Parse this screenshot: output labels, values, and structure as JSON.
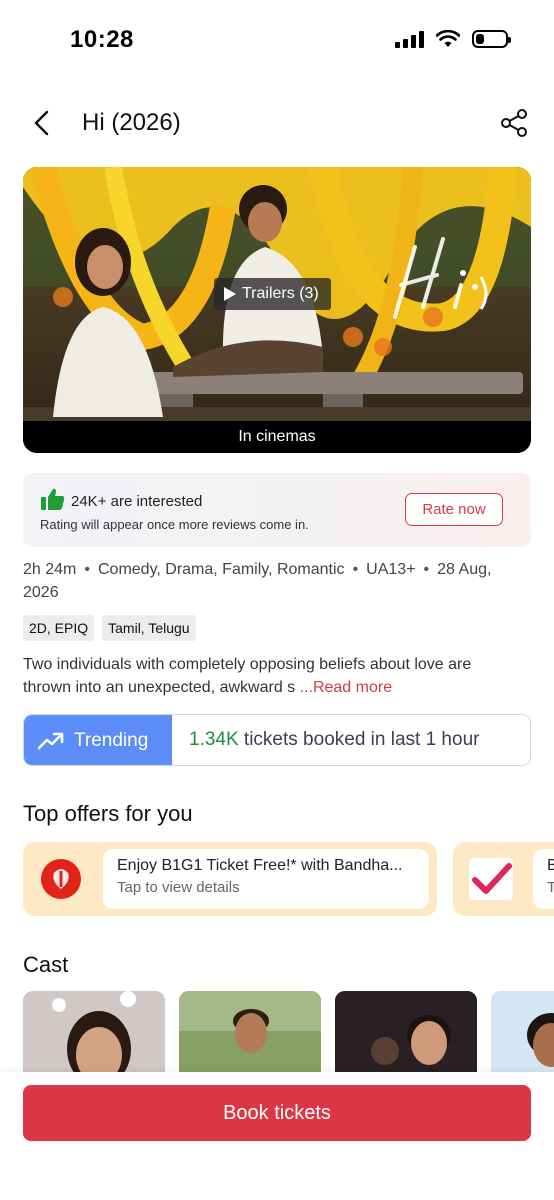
{
  "status_bar": {
    "time": "10:28",
    "battery_level": 0.3
  },
  "header": {
    "title": "Hi (2026)",
    "back_icon": "chevron-left-icon",
    "share_icon": "share-icon"
  },
  "poster": {
    "trailer_label": "Trailers (3)",
    "caption": "In cinemas",
    "overlay_title_art": "Hi :)"
  },
  "interest": {
    "count_text": "24K+ are interested",
    "subtext": "Rating will appear once more reviews come in.",
    "rate_button": "Rate now",
    "accent": "#d73a4a"
  },
  "meta": {
    "duration": "2h 24m",
    "genres": "Comedy, Drama, Family, Romantic",
    "certificate": "UA13+",
    "release_date": "28 Aug, 2026",
    "formats": "2D, EPIQ",
    "languages": "Tamil, Telugu"
  },
  "synopsis": {
    "text": "Two individuals with completely opposing beliefs about love are thrown into an unexpected, awkward s ",
    "read_more": "...Read more"
  },
  "trending": {
    "label": "Trending",
    "count": "1.34K",
    "suffix": " tickets booked in last 1 hour",
    "color": "#5b8cf7"
  },
  "offers": {
    "section_title": "Top offers for you",
    "items": [
      {
        "title": "Enjoy B1G1 Ticket Free!* with Bandha...",
        "subtitle": "Tap to view details",
        "logo": "bandhan-bank-logo"
      },
      {
        "title": "B",
        "subtitle": "T",
        "logo": "kotak-check-logo"
      }
    ]
  },
  "cast": {
    "section_title": "Cast"
  },
  "cta": {
    "book_button": "Book tickets",
    "color": "#dc3545"
  }
}
